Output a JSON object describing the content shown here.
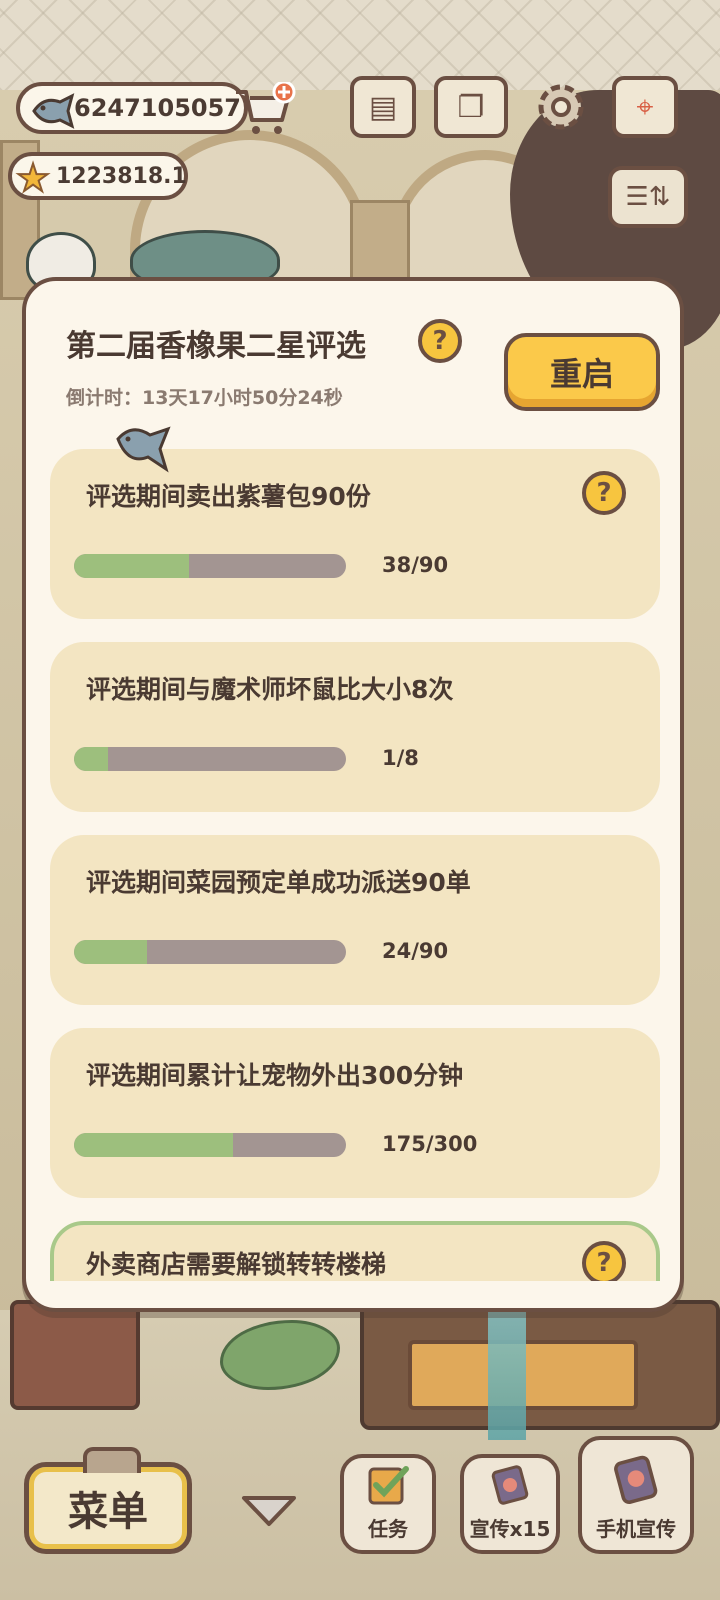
{
  "hud": {
    "fish_currency": "6247105057",
    "star_currency": "1223818.1"
  },
  "modal": {
    "title": "第二届香橡果二星评选",
    "help_icon": "question-icon",
    "countdown": "倒计时：13天17小时50分24秒",
    "restart_label": "重启",
    "tasks": [
      {
        "label": "评选期间卖出紫薯包90份",
        "progress_text": "38/90",
        "current": 38,
        "total": 90,
        "has_help": true
      },
      {
        "label": "评选期间与魔术师坏鼠比大小8次",
        "progress_text": "1/8",
        "current": 1,
        "total": 8,
        "has_help": false
      },
      {
        "label": "评选期间菜园预定单成功派送90单",
        "progress_text": "24/90",
        "current": 24,
        "total": 90,
        "has_help": false
      },
      {
        "label": "评选期间累计让宠物外出300分钟",
        "progress_text": "175/300",
        "current": 175,
        "total": 300,
        "has_help": false
      },
      {
        "label": "外卖商店需要解锁转转楼梯",
        "has_help": true
      }
    ]
  },
  "bottom_bar": {
    "menu_label": "菜单",
    "tasks_label": "任务",
    "promote_label": "宣传x15",
    "phone_promote_label": "手机宣传"
  },
  "colors": {
    "progress_fill": "#9dbf7d",
    "progress_track": "#a39592",
    "accent_yellow": "#fbc94a",
    "border_brown": "#6b4f42",
    "card_bg": "#f3e5c2"
  }
}
